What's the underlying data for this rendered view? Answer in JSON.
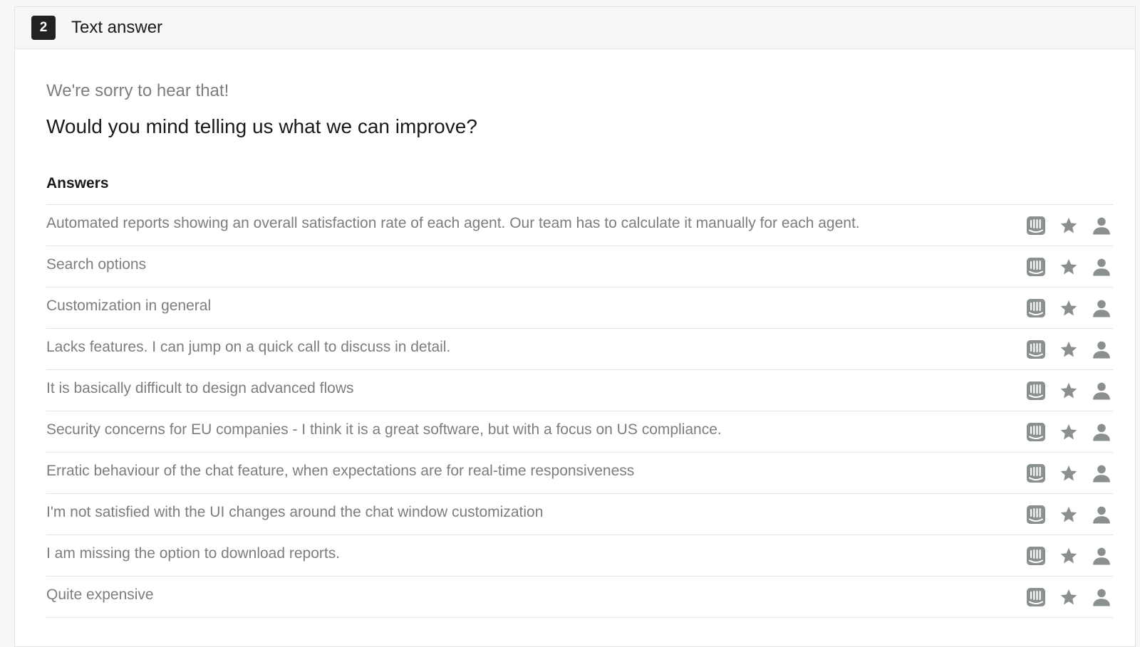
{
  "header": {
    "step_number": "2",
    "title": "Text answer"
  },
  "intro_text": "We're sorry to hear that!",
  "question_text": "Would you mind telling us what we can improve?",
  "answers_heading": "Answers",
  "colors": {
    "icon": "#8a908c",
    "muted_text": "#7a7f7c",
    "badge_bg": "#222222"
  },
  "row_icons": [
    "intercom-icon",
    "star-icon",
    "person-icon"
  ],
  "answers": [
    "Automated reports showing an overall satisfaction rate of each agent. Our team has to calculate it manually for each agent.",
    "Search options",
    "Customization in general",
    "Lacks features. I can jump on a quick call to discuss in detail.",
    "It is basically difficult to design advanced flows",
    "Security concerns for EU companies - I think it is a great software, but with a focus on US compliance.",
    "Erratic behaviour of the chat feature, when expectations are for real-time responsiveness",
    "I'm not satisfied with the UI changes around the chat window customization",
    "I am missing the option to download reports.",
    "Quite expensive"
  ]
}
